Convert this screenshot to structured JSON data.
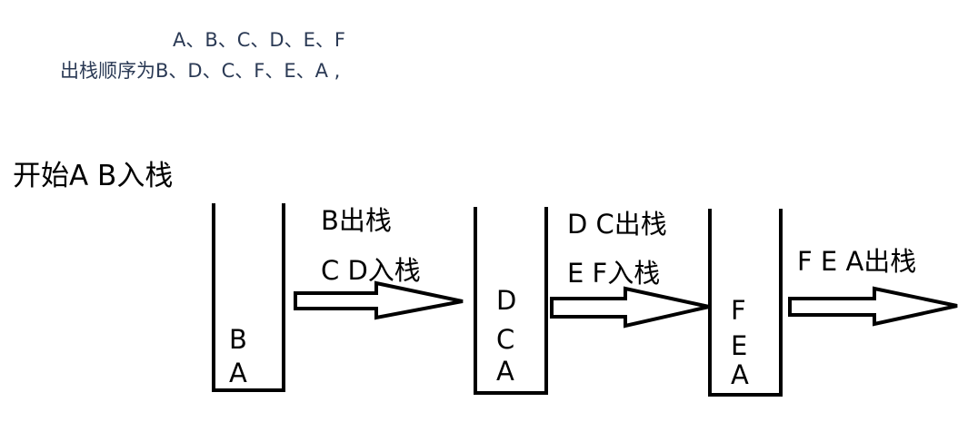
{
  "header": {
    "input_sequence": "A、B、C、D、E、F",
    "output_sequence": "出栈顺序为B、D、C、F、E、A ,"
  },
  "intro": "开始A B入栈",
  "stacks": [
    {
      "items": [
        "B",
        "A"
      ]
    },
    {
      "items": [
        "D",
        "C",
        "A"
      ]
    },
    {
      "items": [
        "F",
        "E",
        "A"
      ]
    }
  ],
  "steps": [
    {
      "line1": "B出栈",
      "line2": "C D入栈"
    },
    {
      "line1": "D C出栈",
      "line2": "E F入栈"
    },
    {
      "line1": "F E A出栈"
    }
  ]
}
